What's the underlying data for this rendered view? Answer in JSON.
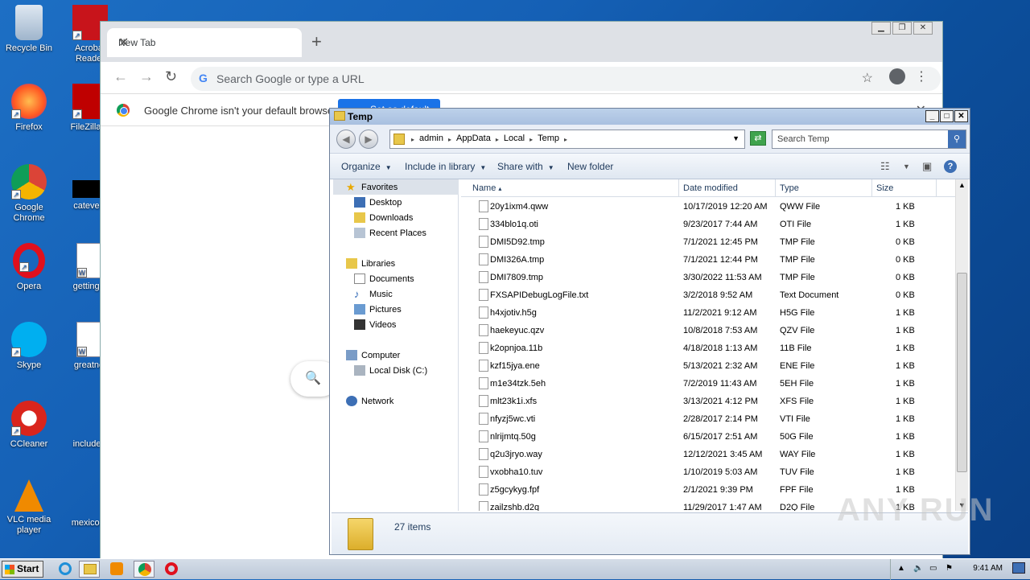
{
  "desktop_icons": [
    {
      "label": "Recycle Bin",
      "id": "recycle-bin"
    },
    {
      "label": "Acrobat Reader",
      "id": "acrobat"
    },
    {
      "label": "Firefox",
      "id": "firefox"
    },
    {
      "label": "FileZilla C",
      "id": "filezilla"
    },
    {
      "label": "Google Chrome",
      "id": "chrome"
    },
    {
      "label": "catevery",
      "id": "catevery"
    },
    {
      "label": "Opera",
      "id": "opera"
    },
    {
      "label": "gettingre",
      "id": "gettingre"
    },
    {
      "label": "Skype",
      "id": "skype"
    },
    {
      "label": "greatnet",
      "id": "greatnet"
    },
    {
      "label": "CCleaner",
      "id": "ccleaner"
    },
    {
      "label": "includesi",
      "id": "includesi"
    },
    {
      "label": "VLC media player",
      "id": "vlc"
    },
    {
      "label": "mexicosa",
      "id": "mexicosa"
    }
  ],
  "chrome": {
    "tab_title": "New Tab",
    "omnibox_placeholder": "Search Google or type a URL",
    "infobar_message": "Google Chrome isn't your default browser",
    "infobar_button": "Set as default"
  },
  "explorer": {
    "title": "Temp",
    "breadcrumbs": [
      "admin",
      "AppData",
      "Local",
      "Temp"
    ],
    "search_placeholder": "Search Temp",
    "commands": [
      "Organize",
      "Include in library",
      "Share with",
      "New folder"
    ],
    "nav": {
      "favorites": "Favorites",
      "favorites_items": [
        "Desktop",
        "Downloads",
        "Recent Places"
      ],
      "libraries": "Libraries",
      "libraries_items": [
        "Documents",
        "Music",
        "Pictures",
        "Videos"
      ],
      "computer": "Computer",
      "computer_items": [
        "Local Disk (C:)"
      ],
      "network": "Network"
    },
    "columns": [
      "Name",
      "Date modified",
      "Type",
      "Size"
    ],
    "files": [
      {
        "name": "20y1ixm4.qww",
        "date": "10/17/2019 12:20 AM",
        "type": "QWW File",
        "size": "1 KB"
      },
      {
        "name": "334blo1q.oti",
        "date": "9/23/2017 7:44 AM",
        "type": "OTI File",
        "size": "1 KB"
      },
      {
        "name": "DMI5D92.tmp",
        "date": "7/1/2021 12:45 PM",
        "type": "TMP File",
        "size": "0 KB"
      },
      {
        "name": "DMI326A.tmp",
        "date": "7/1/2021 12:44 PM",
        "type": "TMP File",
        "size": "0 KB"
      },
      {
        "name": "DMI7809.tmp",
        "date": "3/30/2022 11:53 AM",
        "type": "TMP File",
        "size": "0 KB"
      },
      {
        "name": "FXSAPIDebugLogFile.txt",
        "date": "3/2/2018 9:52 AM",
        "type": "Text Document",
        "size": "0 KB"
      },
      {
        "name": "h4xjotiv.h5g",
        "date": "11/2/2021 9:12 AM",
        "type": "H5G File",
        "size": "1 KB"
      },
      {
        "name": "haekeyuc.qzv",
        "date": "10/8/2018 7:53 AM",
        "type": "QZV File",
        "size": "1 KB"
      },
      {
        "name": "k2opnjoa.11b",
        "date": "4/18/2018 1:13 AM",
        "type": "11B File",
        "size": "1 KB"
      },
      {
        "name": "kzf15jya.ene",
        "date": "5/13/2021 2:32 AM",
        "type": "ENE File",
        "size": "1 KB"
      },
      {
        "name": "m1e34tzk.5eh",
        "date": "7/2/2019 11:43 AM",
        "type": "5EH File",
        "size": "1 KB"
      },
      {
        "name": "mlt23k1i.xfs",
        "date": "3/13/2021 4:12 PM",
        "type": "XFS File",
        "size": "1 KB"
      },
      {
        "name": "nfyzj5wc.vti",
        "date": "2/28/2017 2:14 PM",
        "type": "VTI File",
        "size": "1 KB"
      },
      {
        "name": "nlrijmtq.50g",
        "date": "6/15/2017 2:51 AM",
        "type": "50G File",
        "size": "1 KB"
      },
      {
        "name": "q2u3jryo.way",
        "date": "12/12/2021 3:45 AM",
        "type": "WAY File",
        "size": "1 KB"
      },
      {
        "name": "vxobha10.tuv",
        "date": "1/10/2019 5:03 AM",
        "type": "TUV File",
        "size": "1 KB"
      },
      {
        "name": "z5gcykyg.fpf",
        "date": "2/1/2021 9:39 PM",
        "type": "FPF File",
        "size": "1 KB"
      },
      {
        "name": "zailzshb.d2q",
        "date": "11/29/2017 1:47 AM",
        "type": "D2Q File",
        "size": "1 KB"
      }
    ],
    "status": "27 items"
  },
  "taskbar": {
    "start": "Start",
    "clock": "9:41 AM"
  },
  "watermark": "ANY RUN"
}
